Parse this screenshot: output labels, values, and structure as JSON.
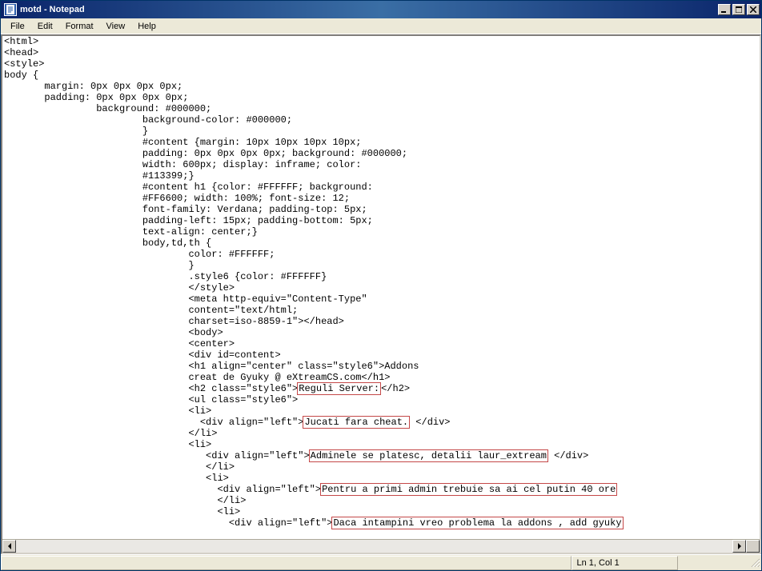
{
  "window": {
    "title": "motd - Notepad"
  },
  "menu": {
    "file": "File",
    "edit": "Edit",
    "format": "Format",
    "view": "View",
    "help": "Help"
  },
  "content": {
    "l1": "<html>",
    "l2": "<head>",
    "l3": "<style>",
    "l4": "body {",
    "l5": "       margin: 0px 0px 0px 0px;",
    "l6": "       padding: 0px 0px 0px 0px;",
    "l7": "                background: #000000;",
    "l8": "                        background-color: #000000;",
    "l9": "                        }",
    "l10": "                        #content {margin: 10px 10px 10px 10px;",
    "l11": "                        padding: 0px 0px 0px 0px; background: #000000;",
    "l12": "                        width: 600px; display: inframe; color:",
    "l13": "                        #113399;}",
    "l14": "                        #content h1 {color: #FFFFFF; background:",
    "l15": "                        #FF6600; width: 100%; font-size: 12;",
    "l16": "                        font-family: Verdana; padding-top: 5px;",
    "l17": "                        padding-left: 15px; padding-bottom: 5px;",
    "l18": "                        text-align: center;}",
    "l19": "                        body,td,th {",
    "l20": "                                color: #FFFFFF;",
    "l21": "                                }",
    "l22": "                                .style6 {color: #FFFFFF}",
    "l23": "                                </style>",
    "l24": "                                <meta http-equiv=\"Content-Type\"",
    "l25": "                                content=\"text/html;",
    "l26": "                                charset=iso-8859-1\"></head>",
    "l27": "                                <body>",
    "l28": "                                <center>",
    "l29": "                                <div id=content>",
    "l30": "                                <h1 align=\"center\" class=\"style6\">Addons",
    "l31": "                                creat de Gyuky @ eXtreamCS.com</h1>",
    "l32a": "                                <h2 class=\"style6\">",
    "l32h": "Reguli Server:",
    "l32b": "</h2>",
    "l33": "                                <ul class=\"style6\">",
    "l34": "                                <li>",
    "l35a": "                                  <div align=\"left\">",
    "l35h": "Jucati fara cheat.",
    "l35b": " </div>",
    "l36": "                                </li>",
    "l37": "                                <li>",
    "l38a": "                                   <div align=\"left\">",
    "l38h": "Adminele se platesc, detalii laur_extream",
    "l38b": " </div>",
    "l39": "                                   </li>",
    "l40": "                                   <li>",
    "l41a": "                                     <div align=\"left\">",
    "l41h": "Pentru a primi admin trebuie sa ai cel putin 40 ore",
    "l42": "                                     </li>",
    "l43": "                                     <li>",
    "l44a": "                                       <div align=\"left\">",
    "l44h": "Daca intampini vreo problema la addons , add gyuky"
  },
  "status": {
    "position": "Ln 1, Col 1"
  }
}
